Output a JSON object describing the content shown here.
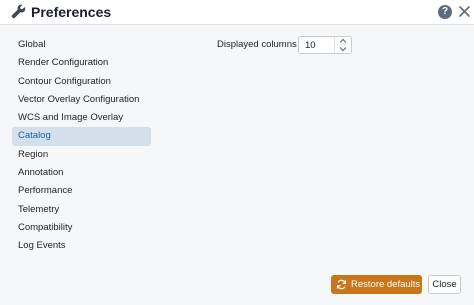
{
  "dialog": {
    "title": "Preferences",
    "help_symbol": "?",
    "icons": {
      "title": "wrench-icon",
      "help": "help-icon",
      "close": "close-icon"
    }
  },
  "tabs": [
    {
      "label": "Global",
      "selected": false
    },
    {
      "label": "Render Configuration",
      "selected": false
    },
    {
      "label": "Contour Configuration",
      "selected": false
    },
    {
      "label": "Vector Overlay Configuration",
      "selected": false
    },
    {
      "label": "WCS and Image Overlay",
      "selected": false
    },
    {
      "label": "Catalog",
      "selected": true
    },
    {
      "label": "Region",
      "selected": false
    },
    {
      "label": "Annotation",
      "selected": false
    },
    {
      "label": "Performance",
      "selected": false
    },
    {
      "label": "Telemetry",
      "selected": false
    },
    {
      "label": "Compatibility",
      "selected": false
    },
    {
      "label": "Log Events",
      "selected": false
    }
  ],
  "catalog": {
    "displayed_columns_label": "Displayed columns",
    "displayed_columns_value": "10"
  },
  "footer": {
    "restore_label": "Restore defaults",
    "close_label": "Close"
  },
  "colors": {
    "accent": "#c87619",
    "selected_tab_bg": "#d3dfea",
    "selected_tab_text": "#215db0",
    "panel_bg": "#f6f7f9"
  }
}
